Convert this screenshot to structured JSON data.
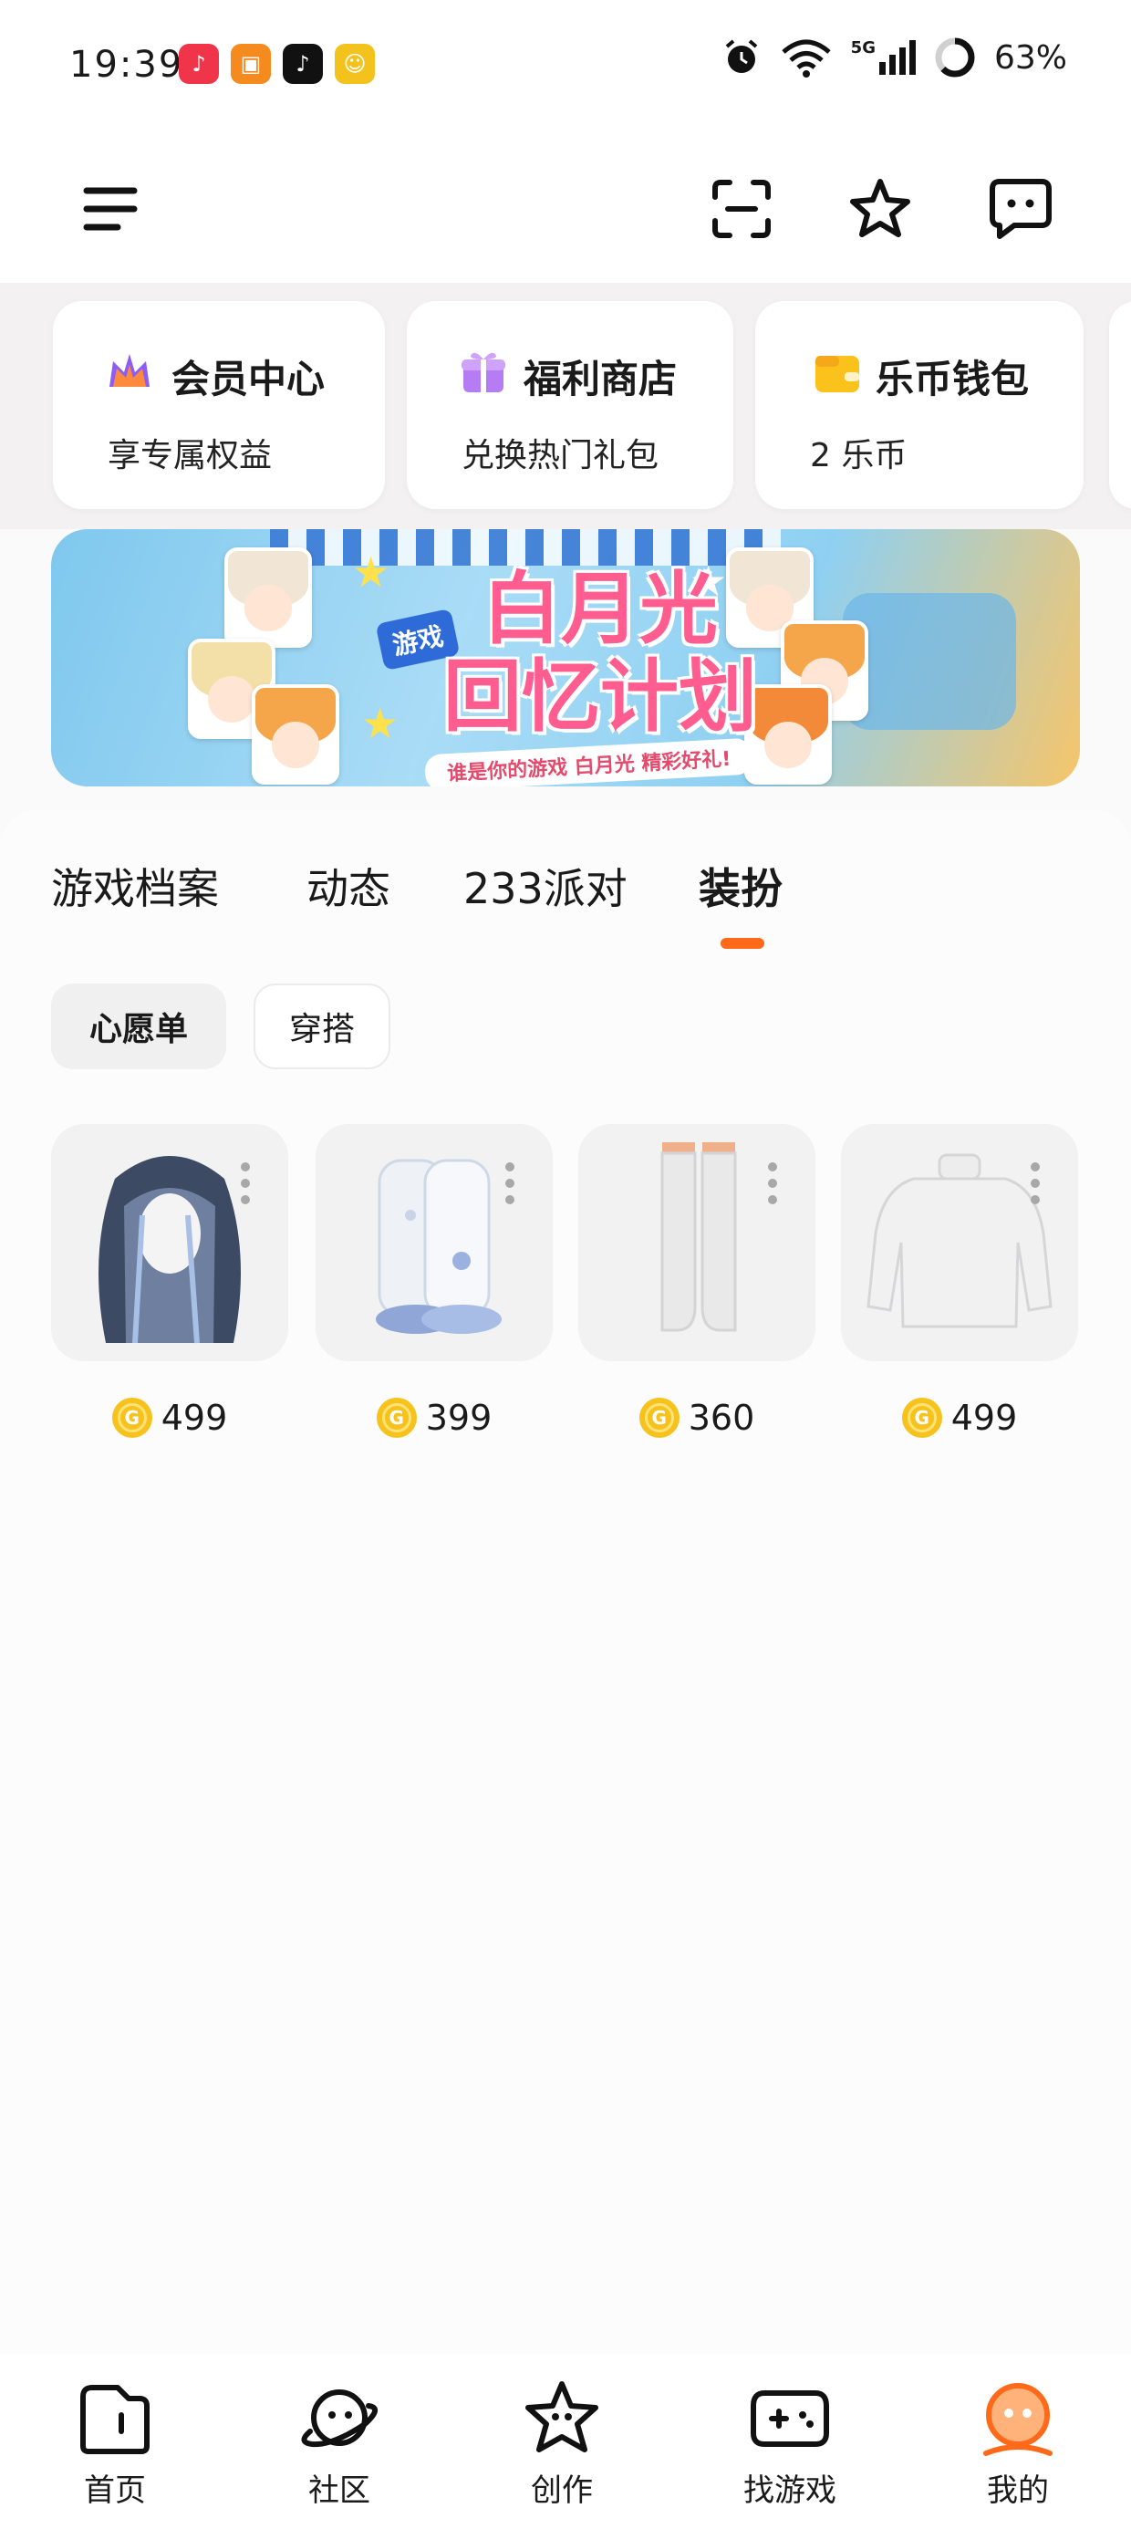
{
  "status_bar": {
    "time": "19:39",
    "network": "5G",
    "battery": "63%",
    "notification_apps": [
      {
        "icon": "music-app-icon",
        "color": "#f0344a"
      },
      {
        "icon": "shopping-app-icon",
        "color": "#f58a1f"
      },
      {
        "icon": "tiktok-app-icon",
        "color": "#111111"
      },
      {
        "icon": "game-app-icon",
        "color": "#f4c21d"
      }
    ]
  },
  "header": {
    "icons": [
      "menu-icon",
      "scan-icon",
      "star-icon",
      "message-icon"
    ]
  },
  "quick_cards": [
    {
      "title": "会员中心",
      "subtitle": "享专属权益",
      "icon": "crown-icon"
    },
    {
      "title": "福利商店",
      "subtitle": "兑换热门礼包",
      "icon": "gift-icon"
    },
    {
      "title": "乐币钱包",
      "subtitle": "2 乐币",
      "icon": "wallet-icon"
    }
  ],
  "banner": {
    "tag": "游戏",
    "headline_line1": "白月光",
    "headline_line2": "回忆计划",
    "ribbon": "谁是你的游戏 白月光 精彩好礼!"
  },
  "tabs": [
    {
      "label": "游戏档案",
      "active": false
    },
    {
      "label": "动态",
      "active": false
    },
    {
      "label": "233派对",
      "active": false
    },
    {
      "label": "装扮",
      "active": true
    }
  ],
  "chips": [
    {
      "label": "心愿单",
      "active": true
    },
    {
      "label": "穿搭",
      "active": false
    }
  ],
  "items": [
    {
      "name": "long-hair",
      "price": "499"
    },
    {
      "name": "fluffy-boots",
      "price": "399"
    },
    {
      "name": "thigh-socks",
      "price": "360"
    },
    {
      "name": "white-sweater",
      "price": "499"
    }
  ],
  "bottom_nav": [
    {
      "label": "首页",
      "icon": "home-icon",
      "active": false
    },
    {
      "label": "社区",
      "icon": "planet-icon",
      "active": false
    },
    {
      "label": "创作",
      "icon": "create-star-icon",
      "active": false
    },
    {
      "label": "找游戏",
      "icon": "gamepad-icon",
      "active": false
    },
    {
      "label": "我的",
      "icon": "profile-avatar-icon",
      "active": true
    }
  ],
  "colors": {
    "accent": "#ff6a1a",
    "coin": "#f7c21b",
    "banner_headline": "#ff5d8f"
  }
}
